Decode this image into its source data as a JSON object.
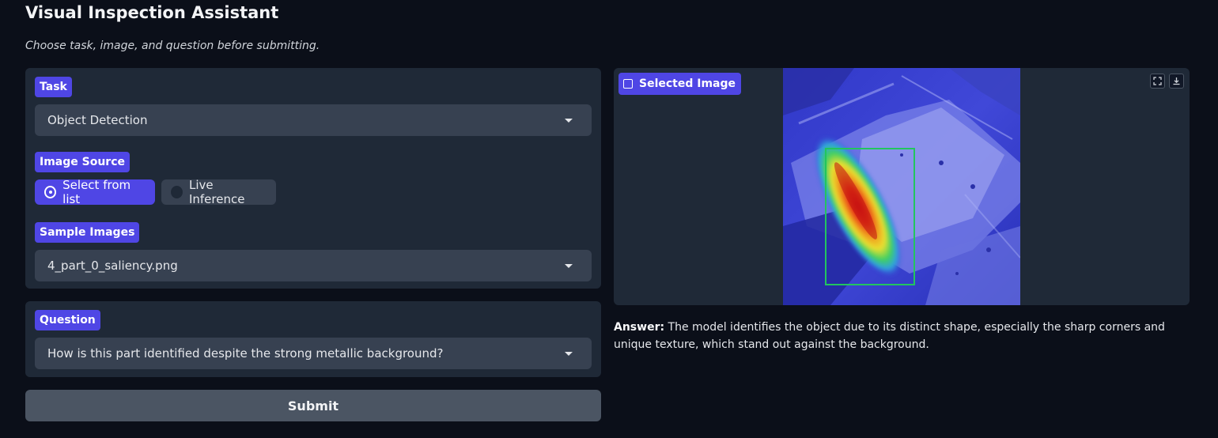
{
  "app": {
    "title": "Visual Inspection Assistant",
    "subtitle": "Choose task, image, and question before submitting."
  },
  "task": {
    "label": "Task",
    "value": "Object Detection"
  },
  "image_source": {
    "label": "Image Source",
    "options": [
      {
        "label": "Select from list",
        "selected": true
      },
      {
        "label": "Live Inference",
        "selected": false
      }
    ]
  },
  "sample_images": {
    "label": "Sample Images",
    "value": "4_part_0_saliency.png"
  },
  "question": {
    "label": "Question",
    "value": "How is this part identified despite the strong metallic background?"
  },
  "submit": {
    "label": "Submit"
  },
  "selected_image": {
    "label": "Selected Image",
    "label_icon": "image-icon",
    "toolbar": [
      "fullscreen-icon",
      "download-icon"
    ]
  },
  "answer": {
    "prefix": "Answer:",
    "text": " The model identifies the object due to its distinct shape, especially the sharp corners and unique texture, which stand out against the background."
  },
  "colors": {
    "background": "#0b0f19",
    "panel": "#1f2937",
    "input": "#374151",
    "accent": "#4f46e5",
    "bbox": "#22c55e"
  }
}
